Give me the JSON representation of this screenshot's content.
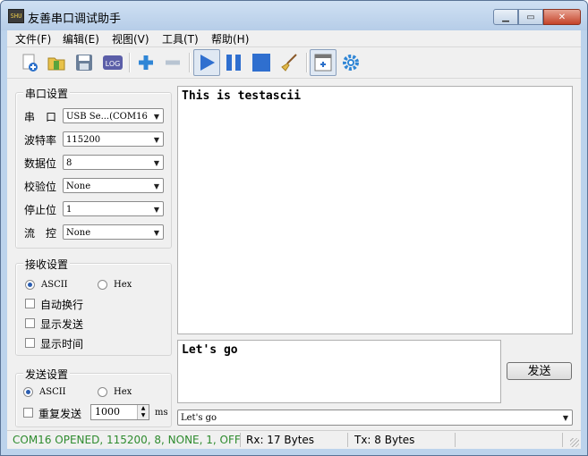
{
  "window": {
    "title": "友善串口调试助手",
    "app_icon_text": "SHU",
    "buttons": [
      "minimize",
      "maximize",
      "close"
    ]
  },
  "menu": [
    {
      "label": "文件(F)"
    },
    {
      "label": "编辑(E)"
    },
    {
      "label": "视图(V)"
    },
    {
      "label": "工具(T)"
    },
    {
      "label": "帮助(H)"
    }
  ],
  "toolbar": {
    "icons": [
      "new-file-icon",
      "open-folder-icon",
      "save-icon",
      "log-icon",
      "plus-icon",
      "minus-icon",
      "play-icon",
      "pause-icon",
      "stop-icon",
      "broom-icon",
      "window-icon",
      "settings-gear-icon"
    ],
    "log_text": "LOG"
  },
  "serial_settings": {
    "title": "串口设置",
    "rows": [
      {
        "label": "串　口",
        "value": "USB Se...(COM16"
      },
      {
        "label": "波特率",
        "value": "115200"
      },
      {
        "label": "数据位",
        "value": "8"
      },
      {
        "label": "校验位",
        "value": "None"
      },
      {
        "label": "停止位",
        "value": "1"
      },
      {
        "label": "流　控",
        "value": "None"
      }
    ]
  },
  "receive_settings": {
    "title": "接收设置",
    "ascii_label": "ASCII",
    "hex_label": "Hex",
    "selected": "ASCII",
    "options": [
      {
        "label": "自动换行",
        "checked": false
      },
      {
        "label": "显示发送",
        "checked": false
      },
      {
        "label": "显示时间",
        "checked": false
      }
    ]
  },
  "send_settings": {
    "title": "发送设置",
    "ascii_label": "ASCII",
    "hex_label": "Hex",
    "selected": "ASCII",
    "repeat_label": "重复发送",
    "repeat_checked": false,
    "interval_value": "1000",
    "interval_unit": "ms"
  },
  "receive_text": "This is testascii",
  "send_text": "Let's go",
  "send_button": "发送",
  "history_value": "Let's go",
  "status": {
    "connection": "COM16 OPENED, 115200, 8, NONE, 1, OFF",
    "rx": "Rx: 17 Bytes",
    "tx": "Tx: 8 Bytes",
    "connection_color": "#2e8b2e"
  }
}
